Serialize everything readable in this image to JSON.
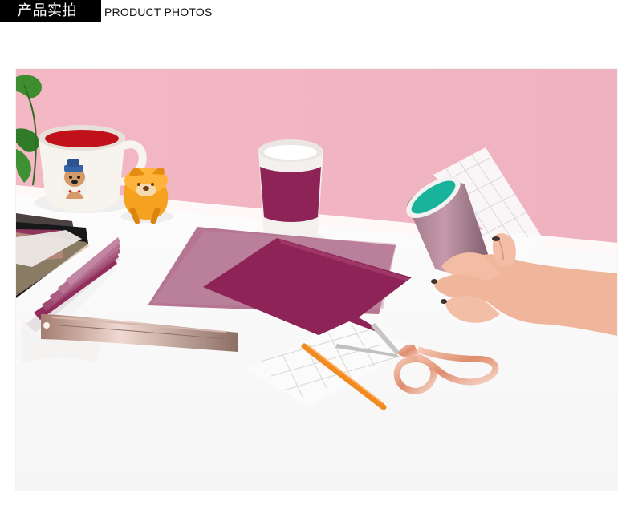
{
  "header": {
    "title_cn": "产品实拍",
    "title_en": "PRODUCT PHOTOS"
  },
  "colors": {
    "header_bg": "#000000",
    "wall": "#f2b6c4",
    "desk": "#fafafa",
    "berry": "#8d2356",
    "berry_light": "#b46b8b",
    "mint": "#19b29a",
    "orange": "#f28a22",
    "rose_gold": "#f0b09a"
  }
}
